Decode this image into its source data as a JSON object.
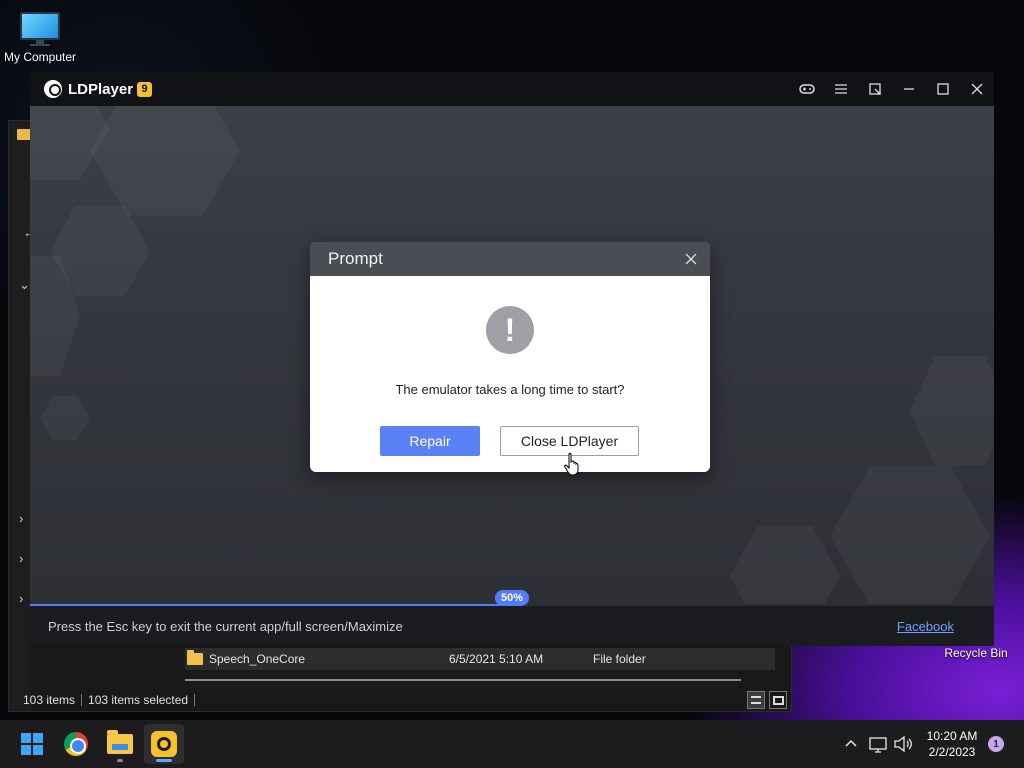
{
  "desktop": {
    "icons": [
      {
        "label": "My Computer",
        "icon": "monitor-icon"
      },
      {
        "label": "Recycle Bin",
        "icon": "recycle-bin-icon"
      }
    ]
  },
  "explorer": {
    "rows": [
      {
        "name": "Speech_OneCore",
        "date": "6/5/2021 5:10 AM",
        "type": "File folder"
      }
    ],
    "status": {
      "items": "103 items",
      "selected": "103 items selected"
    }
  },
  "ldplayer": {
    "title": "LDPlayer",
    "version_badge": "9",
    "controls": [
      "gamepad-icon",
      "menu-icon",
      "resize-icon",
      "minimize-icon",
      "maximize-icon",
      "close-icon"
    ],
    "progress": {
      "percent": 50,
      "label": "50%",
      "color": "#4f7cff"
    },
    "footer_hint": "Press the Esc key to exit the current app/full screen/Maximize",
    "footer_link": "Facebook"
  },
  "dialog": {
    "title": "Prompt",
    "icon": "exclamation-icon",
    "message": "The emulator takes a long time to start?",
    "buttons": {
      "repair": "Repair",
      "close": "Close LDPlayer"
    },
    "accent": "#5b82f4"
  },
  "taskbar": {
    "apps": [
      "windows-start-icon",
      "chrome-icon",
      "file-explorer-icon",
      "ldplayer-icon"
    ],
    "clock": {
      "time": "10:20 AM",
      "date": "2/2/2023"
    },
    "notification_count": "1"
  }
}
